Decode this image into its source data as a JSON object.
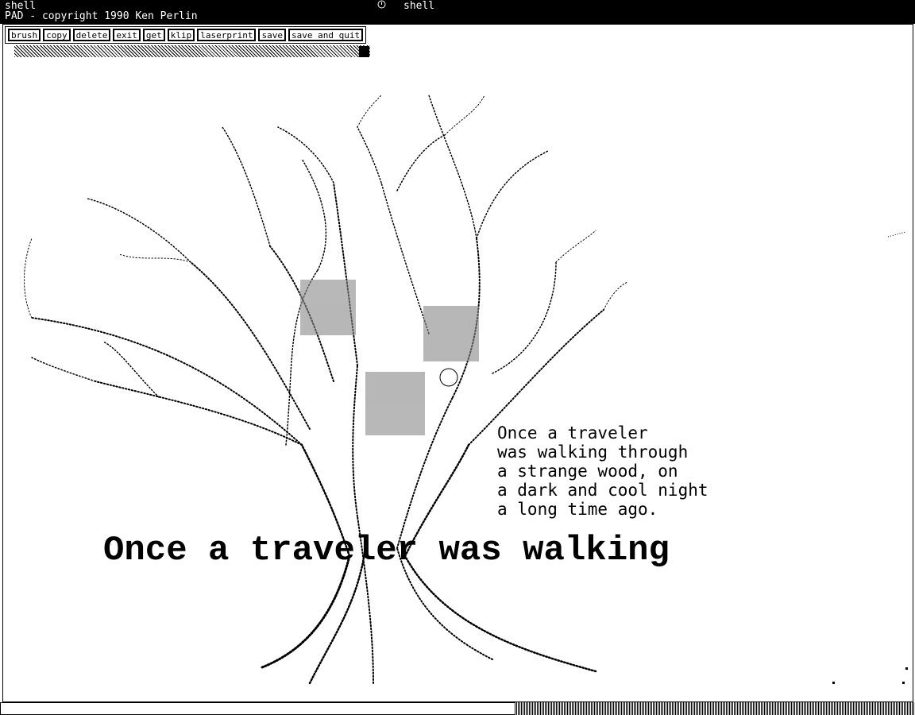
{
  "titlebar": {
    "left_title": "shell",
    "app_line": "PAD - copyright 1990 Ken Perlin",
    "center_title": "shell"
  },
  "menu": {
    "items": [
      "brush",
      "copy",
      "delete",
      "exit",
      "get",
      "klip",
      "laserprint",
      "save",
      "save and quit"
    ]
  },
  "poem": {
    "lines": [
      "Once a traveler",
      "was walking through",
      "a strange wood, on",
      "a dark and cool night",
      "a long time ago."
    ]
  },
  "headline": "Once a traveler was walking"
}
